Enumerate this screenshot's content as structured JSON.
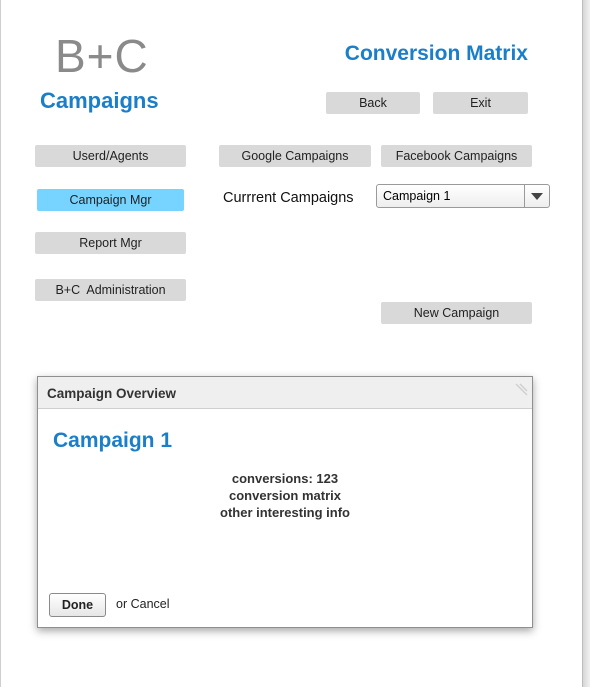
{
  "header": {
    "logo": "B+C",
    "subtitle": "Campaigns",
    "title": "Conversion Matrix",
    "back_label": "Back",
    "exit_label": "Exit"
  },
  "sidebar": {
    "items": [
      {
        "label": "Userd/Agents",
        "active": false
      },
      {
        "label": "Campaign Mgr",
        "active": true
      },
      {
        "label": "Report Mgr",
        "active": false
      },
      {
        "label": "B+C  Administration",
        "active": false
      }
    ]
  },
  "main": {
    "tabs": [
      {
        "label": "Google Campaigns"
      },
      {
        "label": "Facebook Campaigns"
      }
    ],
    "current_label": "Currrent Campaigns",
    "current_selected": "Campaign 1",
    "new_campaign_label": "New Campaign"
  },
  "dialog": {
    "header": "Campaign Overview",
    "title": "Campaign 1",
    "lines": [
      "conversions: 123",
      "conversion matrix",
      "other interesting info"
    ],
    "done_label": "Done",
    "cancel_text": "or Cancel"
  },
  "colors": {
    "accent": "#1a7ec9",
    "active_nav": "#77d3ff",
    "button_gray": "#d9d9d9"
  }
}
